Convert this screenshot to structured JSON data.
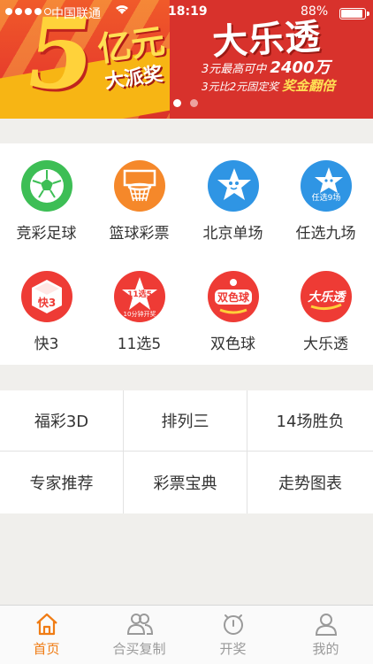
{
  "status_bar": {
    "carrier": "中国联通",
    "time": "18:19",
    "battery": "88%"
  },
  "banner": {
    "big_number": "5",
    "amount_text": "亿元",
    "subtitle": "大派奖",
    "game_title": "大乐透",
    "line1_prefix": "3元最高可中",
    "line1_value": "2400万",
    "line2_prefix": "3元比2元固定奖",
    "line2_highlight": "奖金翻倍"
  },
  "categories": [
    {
      "label": "竞彩足球",
      "icon": "soccer-ball-icon",
      "color": "#3dbe55"
    },
    {
      "label": "篮球彩票",
      "icon": "basketball-hoop-icon",
      "color": "#f5882a"
    },
    {
      "label": "北京单场",
      "icon": "star-mascot-icon",
      "color": "#2f95e4"
    },
    {
      "label": "任选九场",
      "icon": "star-mascot-9-icon",
      "color": "#2f95e4",
      "badge": "任选9场"
    },
    {
      "label": "快3",
      "icon": "dice-icon",
      "color": "#ee3b35",
      "badge": "快3"
    },
    {
      "label": "11选5",
      "icon": "star-11x5-icon",
      "color": "#ee3b35",
      "badge": "11选5",
      "badge2": "10分钟开奖"
    },
    {
      "label": "双色球",
      "icon": "shuangseqiu-logo-icon",
      "color": "#ee3b35",
      "badge": "双色球"
    },
    {
      "label": "大乐透",
      "icon": "daletou-logo-icon",
      "color": "#ee3b35",
      "badge": "大乐透"
    }
  ],
  "menu": [
    {
      "label": "福彩3D"
    },
    {
      "label": "排列三"
    },
    {
      "label": "14场胜负"
    },
    {
      "label": "专家推荐"
    },
    {
      "label": "彩票宝典"
    },
    {
      "label": "走势图表"
    }
  ],
  "tabs": [
    {
      "label": "首页",
      "icon": "home-icon",
      "active": true
    },
    {
      "label": "合买复制",
      "icon": "group-users-icon",
      "active": false
    },
    {
      "label": "开奖",
      "icon": "alarm-clock-icon",
      "active": false
    },
    {
      "label": "我的",
      "icon": "user-icon",
      "active": false
    }
  ],
  "colors": {
    "accent": "#f07c14",
    "inactive": "#9a9a9a",
    "background": "#f0efec"
  }
}
